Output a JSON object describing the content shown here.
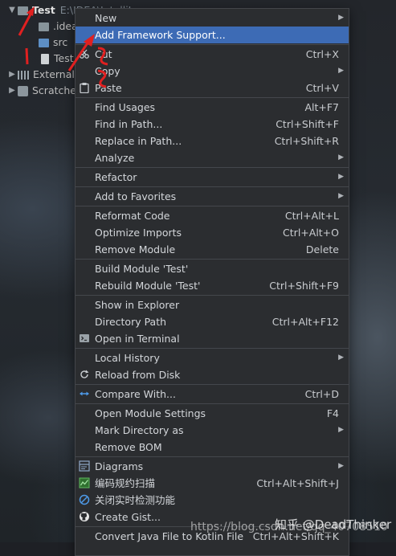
{
  "tree": {
    "project_name": "Test",
    "project_path": "E:\\IDEA\\IntelliJ",
    "items": [
      {
        "label": ".idea"
      },
      {
        "label": "src"
      },
      {
        "label": "Test.iml"
      },
      {
        "label": "External Libraries"
      },
      {
        "label": "Scratches and Consoles"
      }
    ]
  },
  "menu": {
    "new": "New",
    "add_framework": "Add Framework Support...",
    "cut": "Cut",
    "cut_sc": "Ctrl+X",
    "copy": "Copy",
    "paste": "Paste",
    "paste_sc": "Ctrl+V",
    "find_usages": "Find Usages",
    "find_usages_sc": "Alt+F7",
    "find_in_path": "Find in Path...",
    "find_in_path_sc": "Ctrl+Shift+F",
    "replace_in_path": "Replace in Path...",
    "replace_in_path_sc": "Ctrl+Shift+R",
    "analyze": "Analyze",
    "refactor": "Refactor",
    "add_favorites": "Add to Favorites",
    "reformat": "Reformat Code",
    "reformat_sc": "Ctrl+Alt+L",
    "optimize": "Optimize Imports",
    "optimize_sc": "Ctrl+Alt+O",
    "remove_module": "Remove Module",
    "remove_module_sc": "Delete",
    "build_module": "Build Module 'Test'",
    "rebuild_module": "Rebuild Module 'Test'",
    "rebuild_module_sc": "Ctrl+Shift+F9",
    "show_explorer": "Show in Explorer",
    "directory_path": "Directory Path",
    "directory_path_sc": "Ctrl+Alt+F12",
    "open_terminal": "Open in Terminal",
    "local_history": "Local History",
    "reload_disk": "Reload from Disk",
    "compare_with": "Compare With...",
    "compare_with_sc": "Ctrl+D",
    "module_settings": "Open Module Settings",
    "module_settings_sc": "F4",
    "mark_directory": "Mark Directory as",
    "remove_bom": "Remove BOM",
    "diagrams": "Diagrams",
    "code_scan": "编码规约扫描",
    "code_scan_sc": "Ctrl+Alt+Shift+J",
    "close_realtime": "关闭实时检测功能",
    "create_gist": "Create Gist...",
    "convert_kotlin": "Convert Java File to Kotlin File",
    "convert_kotlin_sc": "Ctrl+Alt+Shift+K"
  },
  "watermark": {
    "url": "https://blog.csdn.net/qq_40708510",
    "zhihu": "知乎 @DeadThinker"
  },
  "colors": {
    "selection": "#3d6bb5",
    "menu_bg": "#2b2d30",
    "annotation": "#e02020"
  }
}
